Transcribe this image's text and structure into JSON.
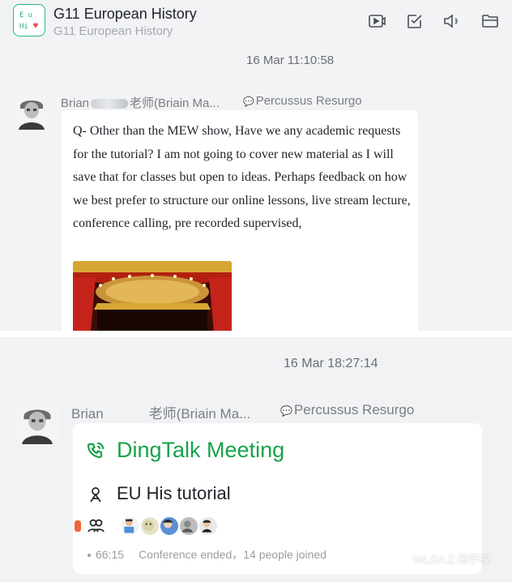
{
  "header": {
    "group_avatar_line1": "Eu",
    "group_avatar_line2": "Hi",
    "title": "G11 European History",
    "subtitle": "G11 European History",
    "icons": [
      "video-icon",
      "task-check-icon",
      "speaker-icon",
      "folder-icon"
    ]
  },
  "message1": {
    "timestamp": "16 Mar 11:10:58",
    "sender_first": "Brian",
    "sender_rest": "老师(Briain Ma...",
    "org": "Percussus Resurgo",
    "text": "Q- Other than the MEW show, Have we any academic requests for the tutorial? I am not going to cover new material as I will save that for classes but open to ideas. Perhaps feedback on how we best prefer to structure our online lessons, live stream lecture, conference calling, pre recorded supervised,"
  },
  "message2": {
    "timestamp": "16 Mar 18:27:14",
    "sender_first": "Brian",
    "sender_rest": "老师(Briain Ma...",
    "org": "Percussus Resurgo",
    "card": {
      "title": "DingTalk Meeting",
      "topic": "EU His tutorial",
      "duration": "66:15",
      "status": "Conference ended，14 people joined"
    }
  },
  "watermark": "WLSA上海学校",
  "colors": {
    "accent_green": "#17a34a",
    "avatar_border": "#2db87d",
    "panel_bg": "#f2f3f5"
  }
}
